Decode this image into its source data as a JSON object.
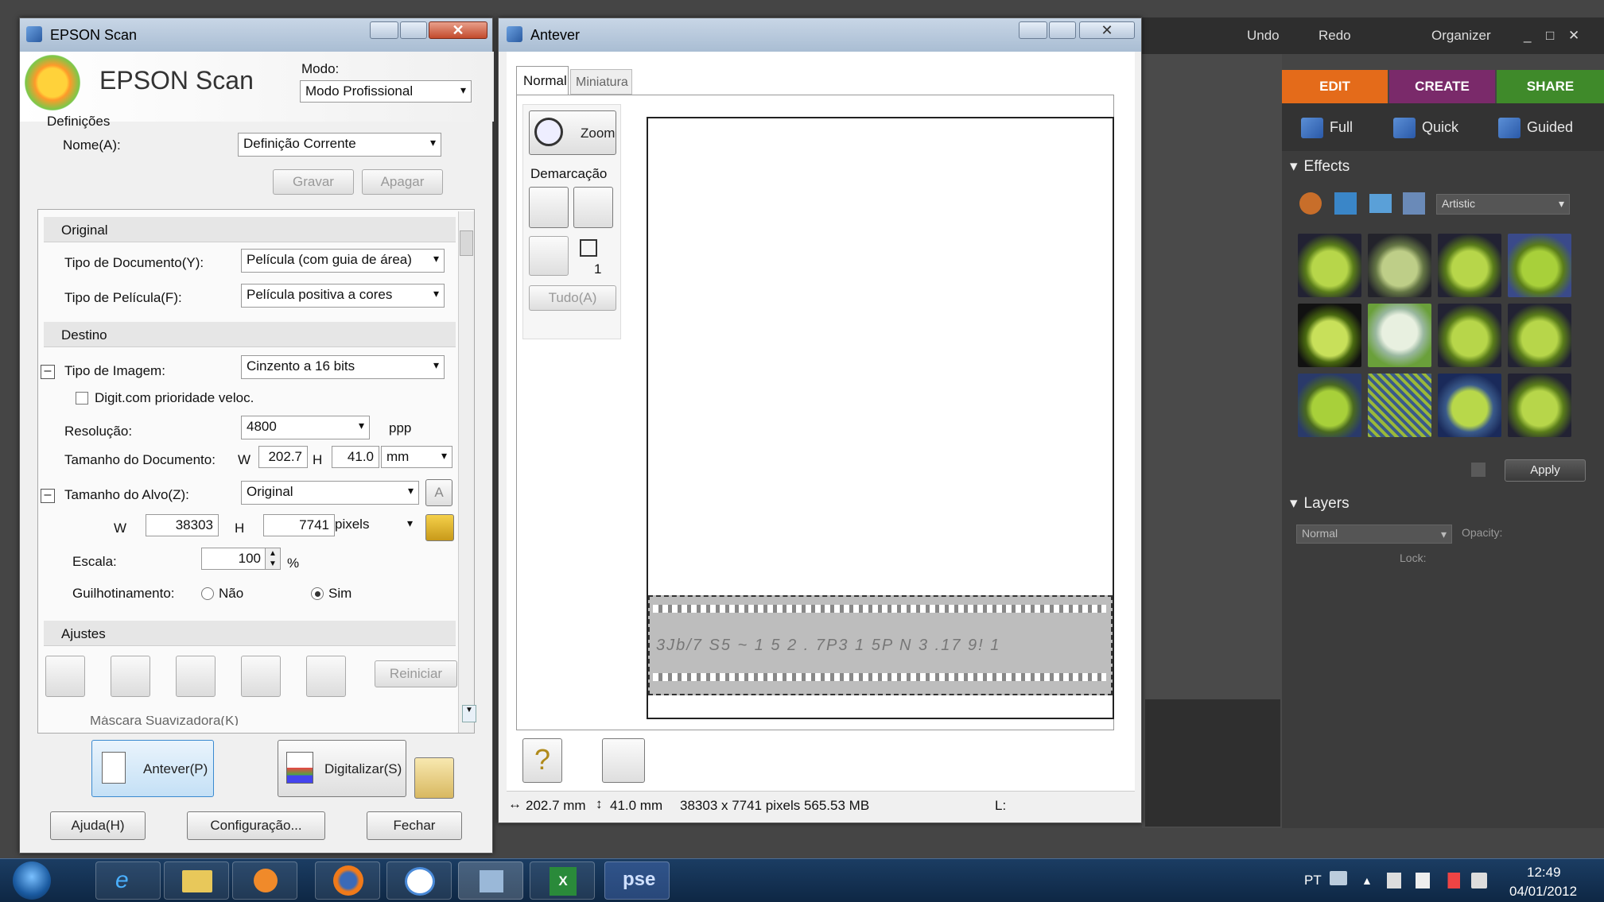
{
  "photoshop": {
    "undo_label": "Undo",
    "redo_label": "Redo",
    "organizer_label": "Organizer",
    "tabs": {
      "edit": "EDIT",
      "create": "CREATE",
      "share": "SHARE"
    },
    "tab_colors": {
      "edit": "#e46b1a",
      "create": "#7a2a6a",
      "share": "#3f8a2a"
    },
    "modes": {
      "full": "Full",
      "quick": "Quick",
      "guided": "Guided"
    },
    "effects_header": "Effects",
    "effects_filter": "Artistic",
    "apply_label": "Apply",
    "layers_header": "Layers",
    "blend_mode": "Normal",
    "opacity_label": "Opacity:",
    "lock_label": "Lock:"
  },
  "epson": {
    "title": "EPSON Scan",
    "logo_text": "EPSON Scan",
    "mode_label": "Modo:",
    "mode_value": "Modo Profissional",
    "definitions_label": "Definições",
    "name_label": "Nome(A):",
    "name_value": "Definição Corrente",
    "save_label": "Gravar",
    "delete_label": "Apagar",
    "original_section": "Original",
    "doc_type_label": "Tipo de Documento(Y):",
    "doc_type_value": "Película (com guia de área)",
    "film_type_label": "Tipo de Película(F):",
    "film_type_value": "Película positiva a cores",
    "dest_section": "Destino",
    "image_type_label": "Tipo de Imagem:",
    "image_type_value": "Cinzento a 16 bits",
    "fast_label": "Digit.com prioridade veloc.",
    "resolution_label": "Resolução:",
    "resolution_value": "4800",
    "resolution_unit": "ppp",
    "docsize_label": "Tamanho do Documento:",
    "w_label": "W",
    "h_label": "H",
    "doc_w": "202.7",
    "doc_h": "41.0",
    "doc_unit": "mm",
    "target_label": "Tamanho do Alvo(Z):",
    "target_value": "Original",
    "target_w": "38303",
    "target_h": "7741",
    "target_unit": "pixels",
    "scale_label": "Escala:",
    "scale_value": "100",
    "scale_unit": "%",
    "trim_label": "Guilhotinamento:",
    "trim_no": "Não",
    "trim_yes": "Sim",
    "adjust_section": "Ajustes",
    "reset_label": "Reiniciar",
    "mask_label": "Máscara Suavizadora(K)",
    "preview_label": "Antever(P)",
    "scan_label": "Digitalizar(S)",
    "help_label": "Ajuda(H)",
    "config_label": "Configuração...",
    "close_label": "Fechar"
  },
  "preview": {
    "title": "Antever",
    "tab_normal": "Normal",
    "tab_thumb": "Miniatura",
    "zoom_label": "Zoom",
    "marquee_label": "Demarcação",
    "marquee_count": "1",
    "all_label": "Tudo(A)",
    "film_text": "3Jb/7 S5 ~ 1 5 2 . 7P3 1 5P N   3 .17 9!  1",
    "status_size": "202.7 mm",
    "status_size2": "41.0 mm",
    "status_pixels": "38303 x 7741 pixels 565.53 MB",
    "status_l": "L:"
  },
  "taskbar": {
    "pse_label": "pse",
    "lang": "PT",
    "time": "12:49",
    "date": "04/01/2012"
  }
}
